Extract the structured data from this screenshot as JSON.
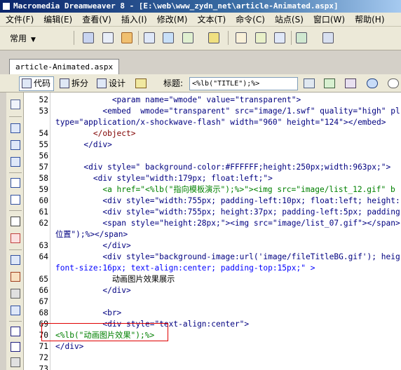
{
  "window": {
    "title": "Macromedia Dreamweaver 8 - [E:\\web\\www_zydn_net\\article-Animated.aspx]"
  },
  "menu": [
    "文件(F)",
    "编辑(E)",
    "查看(V)",
    "插入(I)",
    "修改(M)",
    "文本(T)",
    "命令(C)",
    "站点(S)",
    "窗口(W)",
    "帮助(H)"
  ],
  "insert_bar": {
    "category": "常用"
  },
  "doc_tab": {
    "label": "article-Animated.aspx"
  },
  "doc_toolbar": {
    "code_label": "代码",
    "split_label": "拆分",
    "design_label": "设计",
    "title_label": "标题:",
    "title_value": "<%lb(\"TITLE\");%>"
  },
  "editor": {
    "lines": [
      {
        "n": "52",
        "text": "            <param name=\"wmode\" value=\"transparent\">"
      },
      {
        "n": "53",
        "text": "          <embed  wmode=\"transparent\" src=\"image/1.swf\" quality=\"high\" pl"
      },
      {
        "n": "",
        "text": "type=\"application/x-shockwave-flash\" width=\"960\" height=\"124\"></embed>"
      },
      {
        "n": "54",
        "text": "        </object>"
      },
      {
        "n": "55",
        "text": "      </div>"
      },
      {
        "n": "56",
        "text": ""
      },
      {
        "n": "57",
        "text": "      <div style=\" background-color:#FFFFFF;height:250px;width:963px;\">"
      },
      {
        "n": "58",
        "text": "        <div style=\"width:179px; float:left;\">"
      },
      {
        "n": "59",
        "text": "          <a href=\"<%lb(\"指向模板演示\");%>\"><img src=\"image/list_12.gif\" b"
      },
      {
        "n": "60",
        "text": "          <div style=\"width:755px; padding-left:10px; float:left; height:"
      },
      {
        "n": "61",
        "text": "          <div style=\"width:755px; height:37px; padding-left:5px; padding"
      },
      {
        "n": "62",
        "text": "          <span style=\"height:28px;\"><img src=\"image/list_07.gif\"></span>"
      },
      {
        "n": "",
        "text": "位置\");%></span>"
      },
      {
        "n": "63",
        "text": "          </div>"
      },
      {
        "n": "64",
        "text": "          <div style=\"background-image:url('image/fileTitleBG.gif'); heig"
      },
      {
        "n": "",
        "text": "font-size:16px; text-align:center; padding-top:15px;\" >"
      },
      {
        "n": "65",
        "text": "            动画图片效果展示"
      },
      {
        "n": "66",
        "text": "          </div>"
      },
      {
        "n": "67",
        "text": ""
      },
      {
        "n": "68",
        "text": "          <br>"
      },
      {
        "n": "69",
        "text": "          <div style=\"text-align:center\">"
      },
      {
        "n": "70",
        "text": "<%lb(\"动画图片效果\");%>"
      },
      {
        "n": "71",
        "text": "</div>"
      },
      {
        "n": "72",
        "text": ""
      },
      {
        "n": "73",
        "text": ""
      }
    ]
  },
  "colors": {
    "tag": "#000080",
    "value": "#0000ff",
    "chinese": "#008000",
    "highlight_border": "#e00000"
  }
}
